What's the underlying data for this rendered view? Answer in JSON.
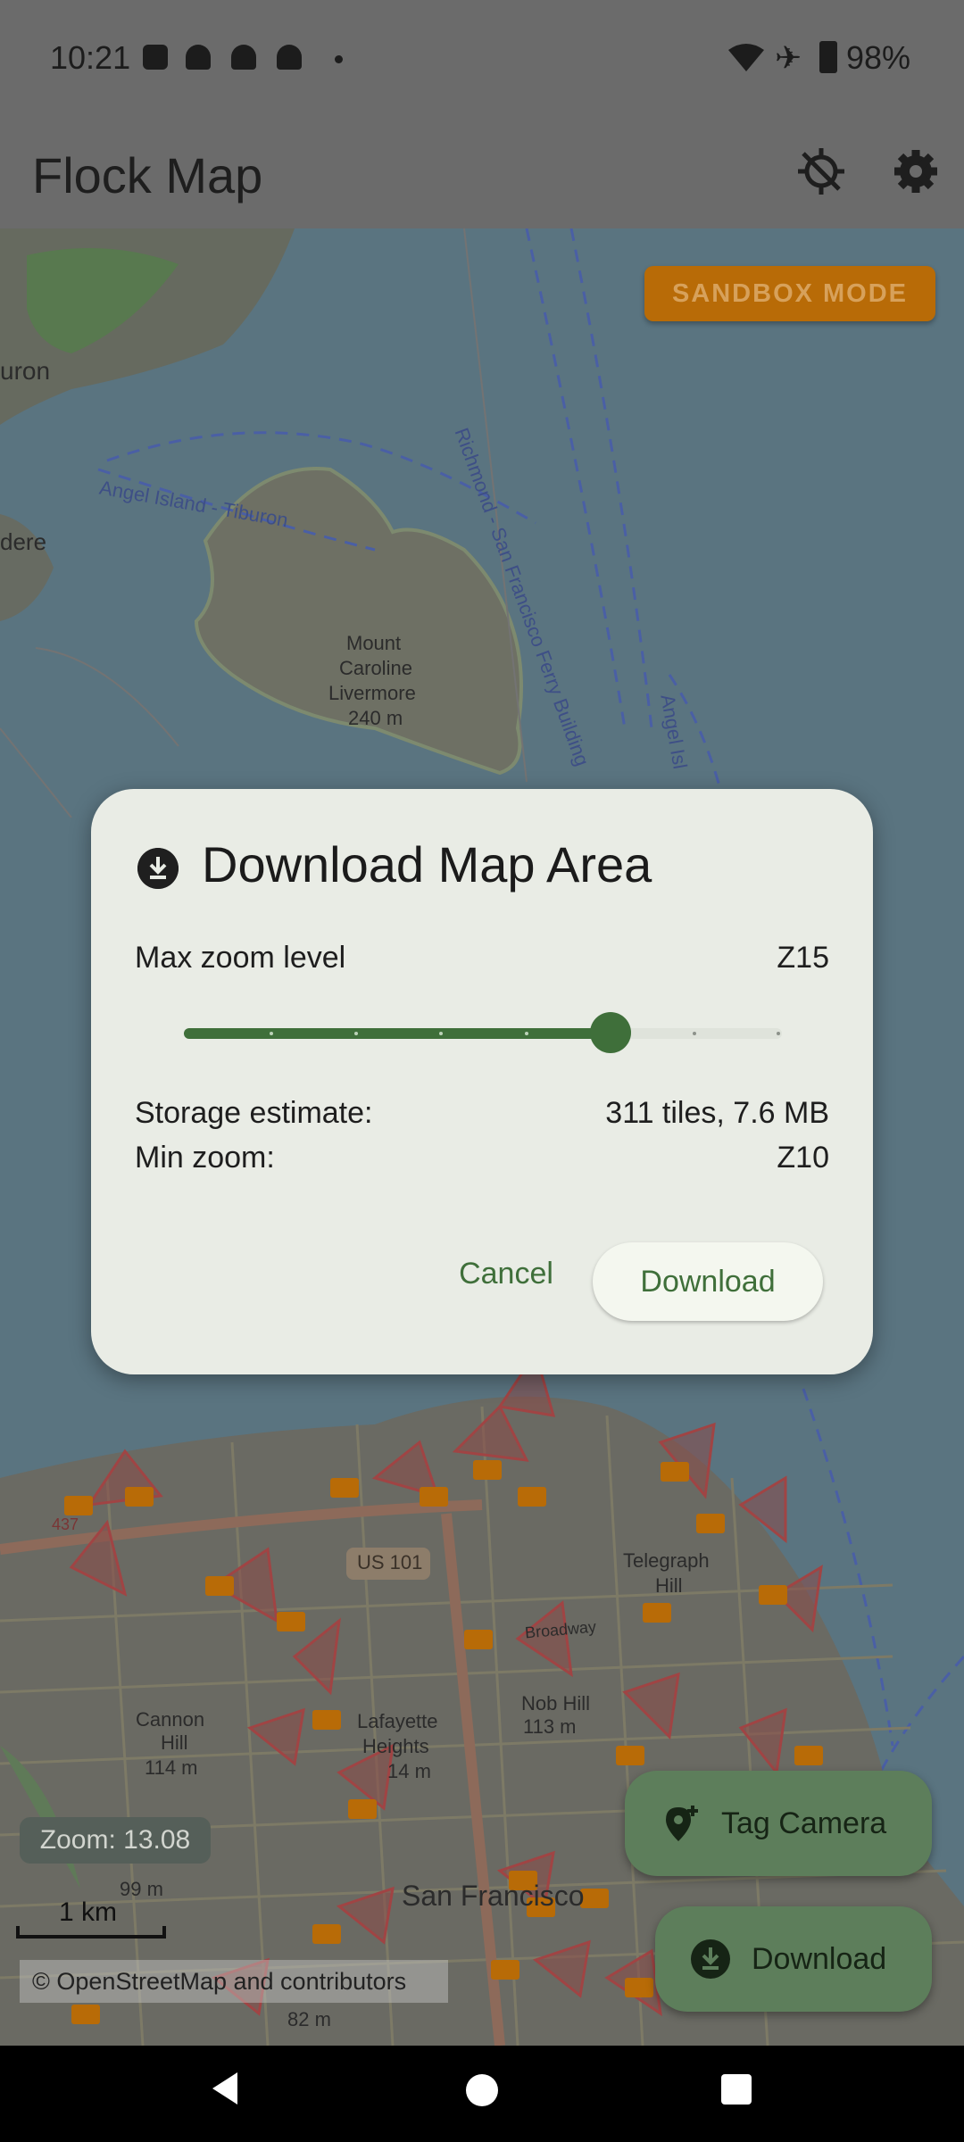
{
  "status_bar": {
    "time": "10:21",
    "battery": "98%"
  },
  "app_bar": {
    "title": "Flock Map"
  },
  "map": {
    "sandbox_label": "SANDBOX MODE",
    "zoom_badge": "Zoom: 13.08",
    "scale_label": "1 km",
    "attribution": "© OpenStreetMap and contributors",
    "labels": [
      "Angel Island - Tiburon",
      "Mount",
      "Caroline",
      "Livermore",
      "240 m",
      "Richmond - San Francisco Ferry Building",
      "Angel Isl",
      "US 101",
      "Telegraph",
      "Hill",
      "Broadway",
      "Cannon",
      "Hill",
      "114 m",
      "Lafayette",
      "Heights",
      "14 m",
      "Nob Hill",
      "113 m",
      "San Francisco",
      "99 m",
      "82 m",
      "uron",
      "dere",
      "437"
    ]
  },
  "dialog": {
    "title": "Download Map Area",
    "max_zoom_label": "Max zoom level",
    "max_zoom_value": "Z15",
    "slider_fraction": 0.714,
    "storage_label": "Storage estimate:",
    "storage_value": "311 tiles, 7.6 MB",
    "min_zoom_label": "Min zoom:",
    "min_zoom_value": "Z10",
    "cancel_label": "Cancel",
    "download_label": "Download"
  },
  "fabs": {
    "tag_camera_label": "Tag Camera",
    "download_label": "Download"
  },
  "colors": {
    "accent": "#3f6f3a",
    "sandbox": "#b86b07",
    "camera_marker": "#b86b07"
  }
}
